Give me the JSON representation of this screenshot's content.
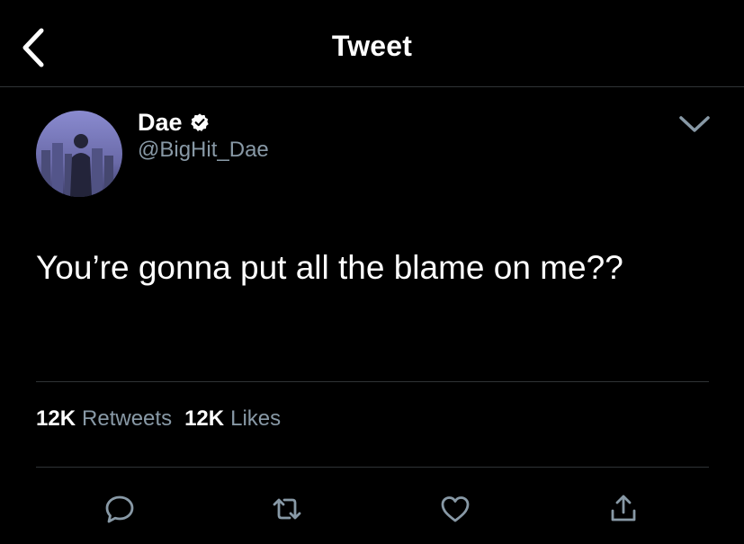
{
  "header": {
    "title": "Tweet",
    "back_icon": "chevron-left-icon"
  },
  "tweet": {
    "author": {
      "display_name": "Dae",
      "handle": "@BigHit_Dae",
      "verified": true
    },
    "text": "You’re gonna put all the blame on me??",
    "stats": {
      "retweets_count": "12K",
      "retweets_label": "Retweets",
      "likes_count": "12K",
      "likes_label": "Likes"
    }
  },
  "actions": [
    {
      "name": "reply",
      "icon": "reply-icon"
    },
    {
      "name": "retweet",
      "icon": "retweet-icon"
    },
    {
      "name": "like",
      "icon": "heart-icon"
    },
    {
      "name": "share",
      "icon": "share-icon"
    }
  ],
  "colors": {
    "background": "#000000",
    "text": "#ffffff",
    "secondary": "#8899a6",
    "divider": "#2f3336",
    "accent": "#1da1f2"
  }
}
